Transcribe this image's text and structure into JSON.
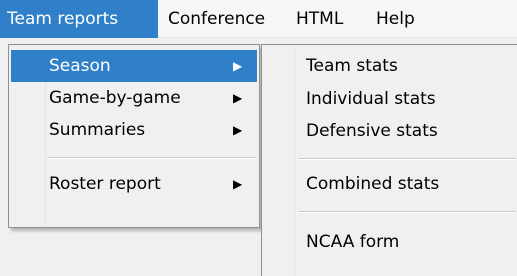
{
  "menubar": {
    "items": [
      {
        "label": "Team reports",
        "active": true
      },
      {
        "label": "Conference",
        "active": false
      },
      {
        "label": "HTML",
        "active": false
      },
      {
        "label": "Help",
        "active": false
      }
    ]
  },
  "dropdown": {
    "items": [
      {
        "label": "Season",
        "has_submenu": true,
        "highlighted": true
      },
      {
        "label": "Game-by-game",
        "has_submenu": true,
        "highlighted": false
      },
      {
        "label": "Summaries",
        "has_submenu": true,
        "highlighted": false
      },
      {
        "label": "Roster report",
        "has_submenu": true,
        "highlighted": false
      }
    ],
    "arrow_icon": "triangle-right-icon"
  },
  "submenu": {
    "items": [
      {
        "label": "Team stats"
      },
      {
        "label": "Individual stats"
      },
      {
        "label": "Defensive stats"
      },
      {
        "label": "Combined stats"
      },
      {
        "label": "NCAA form"
      }
    ]
  },
  "colors": {
    "highlight": "#2f80c9",
    "menu_bg": "#f0f0f0",
    "border": "#8e8f8f"
  }
}
